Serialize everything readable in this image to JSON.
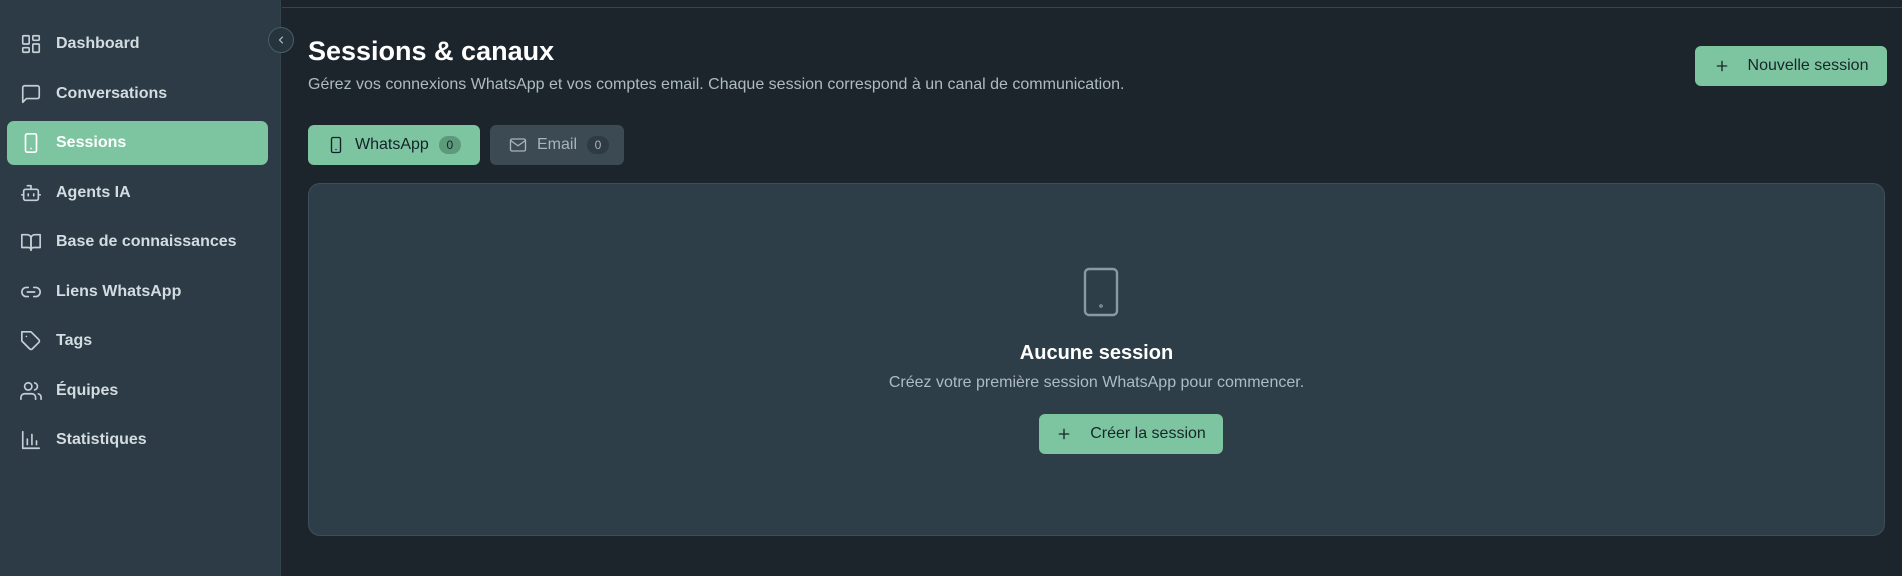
{
  "sidebar": {
    "items": [
      {
        "label": "Dashboard",
        "icon": "dashboard-icon"
      },
      {
        "label": "Conversations",
        "icon": "message-square-icon"
      },
      {
        "label": "Sessions",
        "icon": "smartphone-icon",
        "active": true
      },
      {
        "label": "Agents IA",
        "icon": "bot-icon"
      },
      {
        "label": "Base de connaissances",
        "icon": "book-open-icon"
      },
      {
        "label": "Liens WhatsApp",
        "icon": "link-icon"
      },
      {
        "label": "Tags",
        "icon": "tag-icon"
      },
      {
        "label": "Équipes",
        "icon": "users-icon"
      },
      {
        "label": "Statistiques",
        "icon": "bar-chart-icon"
      }
    ],
    "collapse_icon": "chevron-left-icon"
  },
  "header": {
    "title": "Sessions & canaux",
    "subtitle": "Gérez vos connexions WhatsApp et vos comptes email. Chaque session correspond à un canal de communication.",
    "new_session_label": "Nouvelle session",
    "new_session_icon": "plus-icon"
  },
  "tabs": [
    {
      "label": "WhatsApp",
      "count": "0",
      "icon": "smartphone-icon",
      "active": true
    },
    {
      "label": "Email",
      "count": "0",
      "icon": "mail-icon",
      "active": false
    }
  ],
  "empty_state": {
    "icon": "smartphone-icon",
    "title": "Aucune session",
    "description": "Créez votre première session WhatsApp pour commencer.",
    "create_label": "Créer la session",
    "create_icon": "plus-icon"
  },
  "colors": {
    "accent": "#7dc5a0",
    "background": "#1c252c",
    "sidebar": "#2c3b45",
    "panel": "#2e3e49"
  }
}
